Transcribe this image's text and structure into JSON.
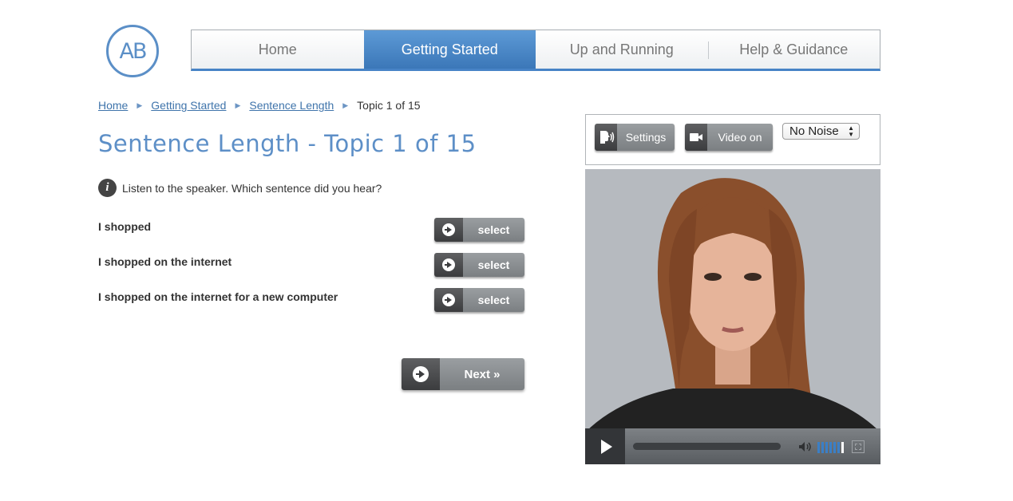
{
  "brand": {
    "logo_text": "AB",
    "accent": "#4783c6",
    "title_color": "#5d8fc7"
  },
  "nav": {
    "tabs": [
      {
        "label": "Home",
        "active": false
      },
      {
        "label": "Getting Started",
        "active": true
      },
      {
        "label": "Up and Running",
        "active": false
      },
      {
        "label": "Help & Guidance",
        "active": false
      }
    ]
  },
  "breadcrumb": {
    "items": [
      "Home",
      "Getting Started",
      "Sentence Length"
    ],
    "current": "Topic 1 of 15"
  },
  "page": {
    "title": "Sentence Length - Topic 1 of 15",
    "instruction": "Listen to the speaker. Which sentence did you hear?"
  },
  "options": [
    {
      "text": "I shopped",
      "button": "select"
    },
    {
      "text": "I shopped on the internet",
      "button": "select"
    },
    {
      "text": "I shopped on the internet for a new computer",
      "button": "select"
    }
  ],
  "next_label": "Next »",
  "controls": {
    "settings_label": "Settings",
    "video_label": "Video on",
    "noise_value": "No Noise"
  },
  "player": {
    "play_icon": "play-icon",
    "volume_icon": "volume-icon",
    "volume_level": 0.85,
    "progress": 0,
    "fullscreen_icon": "fullscreen-icon"
  }
}
